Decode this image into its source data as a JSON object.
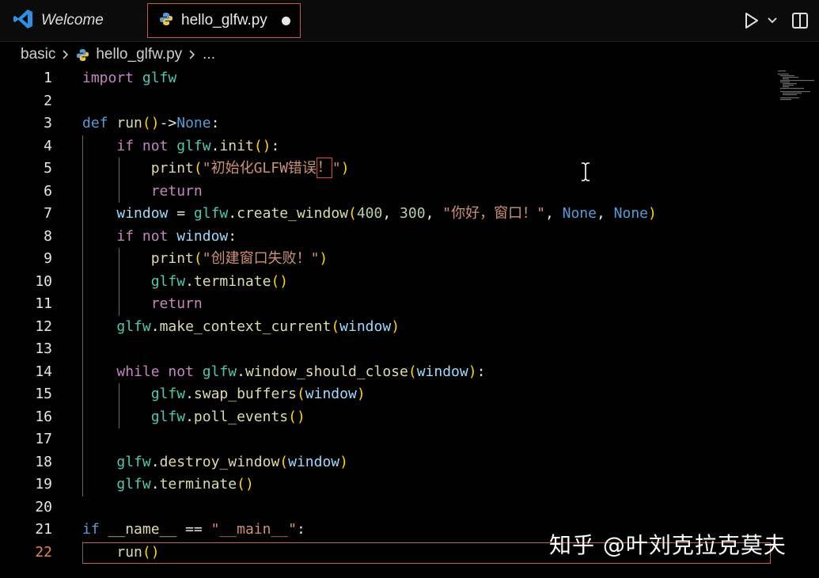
{
  "tabs": [
    {
      "label": "Welcome",
      "icon": "vscode-logo-icon",
      "active": false
    },
    {
      "label": "hello_glfw.py",
      "icon": "python-icon",
      "active": true,
      "dirty": true
    }
  ],
  "breadcrumb": {
    "folder": "basic",
    "file": "hello_glfw.py",
    "more": "..."
  },
  "editor": {
    "current_line": 22,
    "line_numbers": [
      "1",
      "2",
      "3",
      "4",
      "5",
      "6",
      "7",
      "8",
      "9",
      "10",
      "11",
      "12",
      "13",
      "14",
      "15",
      "16",
      "17",
      "18",
      "19",
      "20",
      "21",
      "22"
    ],
    "lines": [
      "import glfw",
      "",
      "def run()->None:",
      "    if not glfw.init():",
      "        print(\"初始化GLFW错误！\")",
      "        return",
      "    window = glfw.create_window(400, 300, \"你好，窗口！\", None, None)",
      "    if not window:",
      "        print(\"创建窗口失败！\")",
      "        glfw.terminate()",
      "        return",
      "    glfw.make_context_current(window)",
      "",
      "    while not glfw.window_should_close(window):",
      "        glfw.swap_buffers(window)",
      "        glfw.poll_events()",
      "",
      "    glfw.destroy_window(window)",
      "    glfw.terminate()",
      "",
      "if __name__ == \"__main__\":",
      "    run()"
    ]
  },
  "watermark": "知乎 @叶刘克拉克莫夫",
  "colors": {
    "keyword": "#c586c0",
    "builtin": "#569cd6",
    "module": "#4ec9b0",
    "function": "#dcdcaa",
    "string": "#ce9178",
    "number": "#b5cea8",
    "variable": "#9cdcfe",
    "accent": "#c9564a"
  }
}
